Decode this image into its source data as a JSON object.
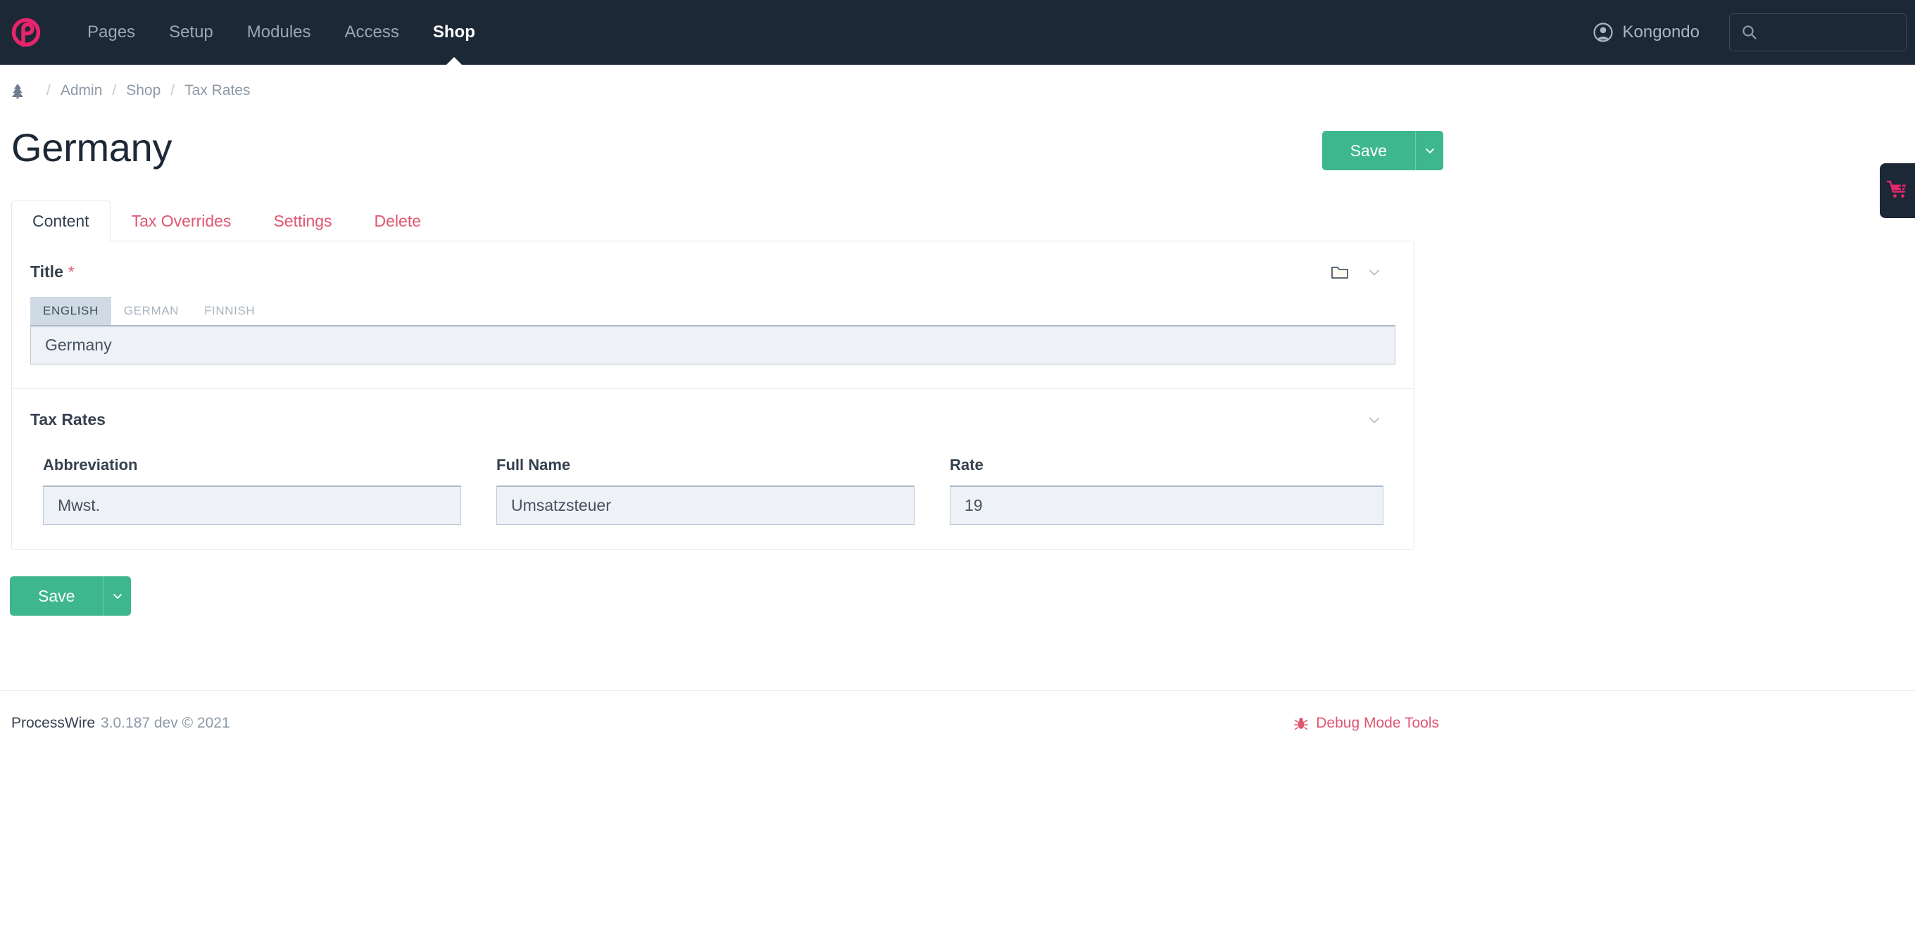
{
  "navbar": {
    "logo_icon": "processwire-logo-icon",
    "links": [
      {
        "label": "Pages",
        "active": false
      },
      {
        "label": "Setup",
        "active": false
      },
      {
        "label": "Modules",
        "active": false
      },
      {
        "label": "Access",
        "active": false
      },
      {
        "label": "Shop",
        "active": true
      }
    ],
    "user": {
      "name": "Kongondo",
      "icon": "user-avatar-icon"
    },
    "search": {
      "value": "",
      "placeholder": "",
      "icon": "search-icon"
    }
  },
  "breadcrumb": {
    "home_icon": "tree-icon",
    "separator": "/",
    "items": [
      {
        "label": "Admin"
      },
      {
        "label": "Shop"
      },
      {
        "label": "Tax Rates"
      }
    ]
  },
  "page": {
    "title": "Germany"
  },
  "save": {
    "label": "Save",
    "caret_icon": "chevron-down-icon"
  },
  "tabs": [
    {
      "label": "Content",
      "active": true
    },
    {
      "label": "Tax Overrides",
      "active": false
    },
    {
      "label": "Settings",
      "active": false
    },
    {
      "label": "Delete",
      "active": false
    }
  ],
  "title_field": {
    "label": "Title",
    "required_marker": "*",
    "folder_icon": "folder-icon",
    "collapse_icon": "chevron-down-icon",
    "languages": [
      {
        "label": "ENGLISH",
        "active": true
      },
      {
        "label": "GERMAN",
        "active": false
      },
      {
        "label": "FINNISH",
        "active": false
      }
    ],
    "value": "Germany",
    "placeholder": ""
  },
  "tax_rates_section": {
    "title": "Tax Rates",
    "collapse_icon": "chevron-down-icon",
    "columns": [
      {
        "label": "Abbreviation",
        "value": "Mwst.",
        "placeholder": ""
      },
      {
        "label": "Full Name",
        "value": "Umsatzsteuer",
        "placeholder": ""
      },
      {
        "label": "Rate",
        "value": "19",
        "placeholder": ""
      }
    ]
  },
  "footer": {
    "product": "ProcessWire",
    "version": "3.0.187 dev © 2021",
    "debug": {
      "label": "Debug Mode Tools",
      "icon": "bug-icon"
    }
  },
  "cart_tab": {
    "icon": "shopping-cart-plus-icon"
  },
  "colors": {
    "nav_bg": "#1c2836",
    "accent_pink": "#e0566f",
    "logo_pink": "#e8246c",
    "primary_green": "#3eb68e",
    "input_bg": "#eef2f7",
    "text_dark": "#35414e",
    "muted": "#8d99a6"
  }
}
